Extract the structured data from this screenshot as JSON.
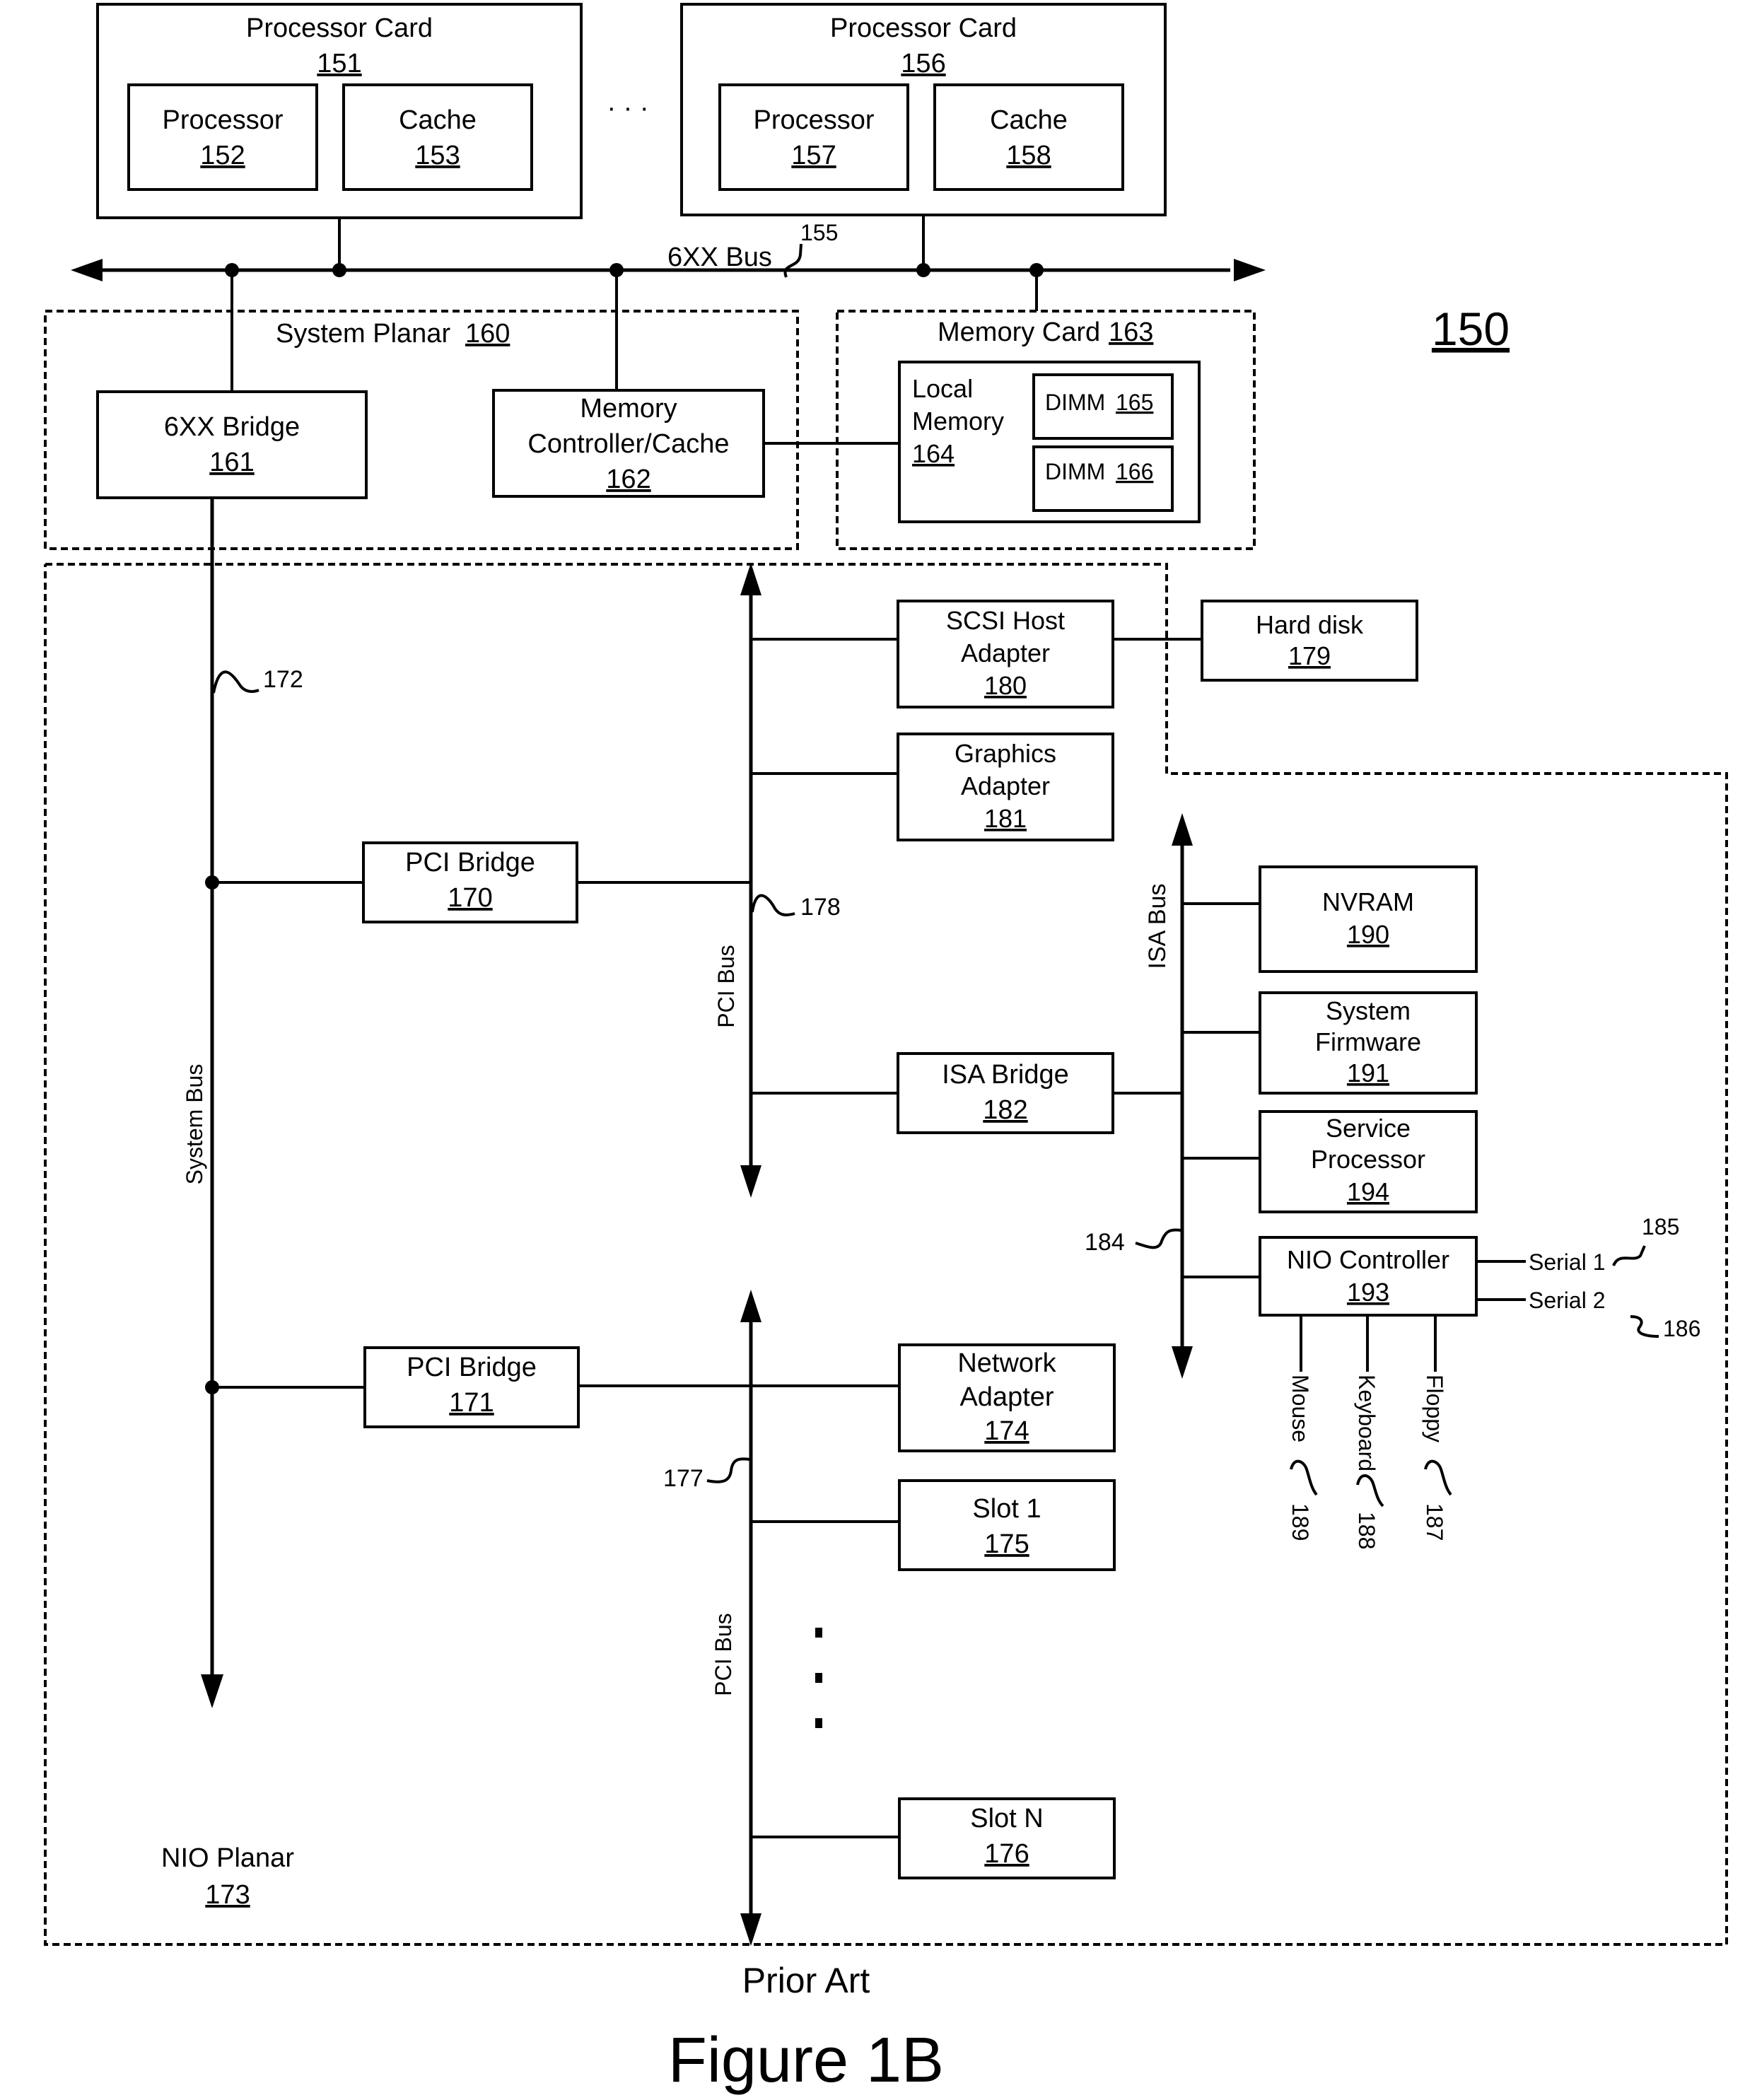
{
  "figure": {
    "ref": "150",
    "caption_top": "Prior Art",
    "caption": "Figure 1B"
  },
  "processor_cards": [
    {
      "label": "Processor Card",
      "ref": "151",
      "processor": {
        "label": "Processor",
        "ref": "152"
      },
      "cache": {
        "label": "Cache",
        "ref": "153"
      }
    },
    {
      "label": "Processor Card",
      "ref": "156",
      "processor": {
        "label": "Processor",
        "ref": "157"
      },
      "cache": {
        "label": "Cache",
        "ref": "158"
      }
    }
  ],
  "ellipsis": "· · ·",
  "bus_6xx": {
    "label": "6XX Bus",
    "ref": "155"
  },
  "system_planar": {
    "label": "System Planar",
    "ref": "160"
  },
  "bridge_6xx": {
    "label": "6XX Bridge",
    "ref": "161"
  },
  "memory_controller": {
    "line1": "Memory",
    "line2": "Controller/Cache",
    "ref": "162"
  },
  "memory_card": {
    "label": "Memory Card",
    "ref": "163"
  },
  "local_memory": {
    "line1": "Local",
    "line2": "Memory",
    "ref": "164"
  },
  "dimms": [
    {
      "label": "DIMM",
      "ref": "165"
    },
    {
      "label": "DIMM",
      "ref": "166"
    }
  ],
  "system_bus": {
    "label": "System Bus",
    "ref": "172"
  },
  "pci_bridges": [
    {
      "label": "PCI Bridge",
      "ref": "170"
    },
    {
      "label": "PCI Bridge",
      "ref": "171"
    }
  ],
  "pci_bus_upper": {
    "label": "PCI Bus",
    "ref": "178"
  },
  "pci_bus_lower": {
    "label": "PCI Bus",
    "ref": "177"
  },
  "scsi": {
    "line1": "SCSI Host",
    "line2": "Adapter",
    "ref": "180"
  },
  "hard_disk": {
    "label": "Hard disk",
    "ref": "179"
  },
  "graphics": {
    "line1": "Graphics",
    "line2": "Adapter",
    "ref": "181"
  },
  "isa_bridge": {
    "label": "ISA Bridge",
    "ref": "182"
  },
  "isa_bus": {
    "label": "ISA Bus",
    "ref": "184"
  },
  "nvram": {
    "label": "NVRAM",
    "ref": "190"
  },
  "firmware": {
    "line1": "System",
    "line2": "Firmware",
    "ref": "191"
  },
  "service_processor": {
    "line1": "Service",
    "line2": "Processor",
    "ref": "194"
  },
  "nio_controller": {
    "label": "NIO Controller",
    "ref": "193"
  },
  "serial_ports": [
    {
      "label": "Serial 1",
      "ref": "185"
    },
    {
      "label": "Serial 2",
      "ref": "186"
    }
  ],
  "nio_ports": [
    {
      "label": "Mouse",
      "ref": "189"
    },
    {
      "label": "Keyboard",
      "ref": "188"
    },
    {
      "label": "Floppy",
      "ref": "187"
    }
  ],
  "network_adapter": {
    "line1": "Network",
    "line2": "Adapter",
    "ref": "174"
  },
  "slot1": {
    "label": "Slot 1",
    "ref": "175"
  },
  "slotN": {
    "label": "Slot N",
    "ref": "176"
  },
  "nio_planar": {
    "label": "NIO Planar",
    "ref": "173"
  }
}
